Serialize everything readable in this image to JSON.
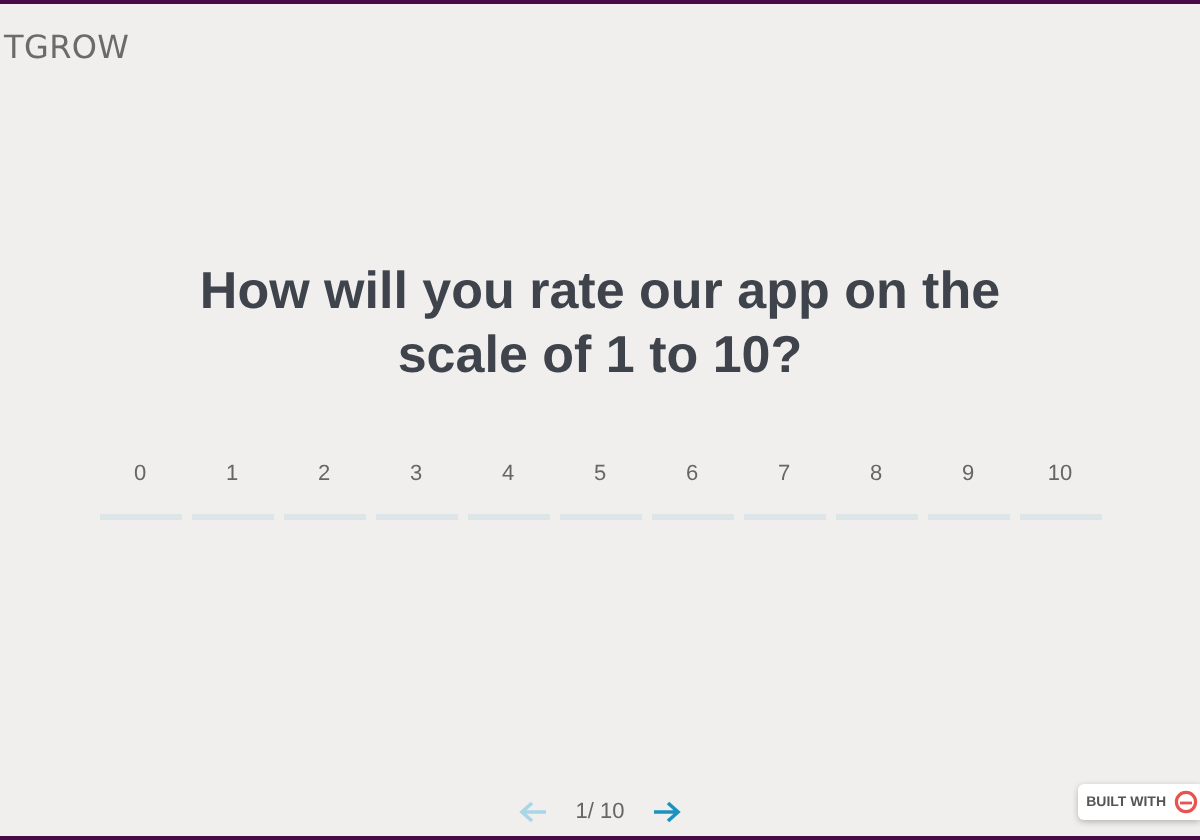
{
  "logo": {
    "text": "TGROW"
  },
  "question": {
    "title": "How will you rate our app on the scale of 1 to 10?"
  },
  "scale": [
    {
      "label": "0",
      "selected": false
    },
    {
      "label": "1",
      "selected": false
    },
    {
      "label": "2",
      "selected": false
    },
    {
      "label": "3",
      "selected": false
    },
    {
      "label": "4",
      "selected": false
    },
    {
      "label": "5",
      "selected": false
    },
    {
      "label": "6",
      "selected": false
    },
    {
      "label": "7",
      "selected": false
    },
    {
      "label": "8",
      "selected": false
    },
    {
      "label": "9",
      "selected": false
    },
    {
      "label": "10",
      "selected": false
    }
  ],
  "navigation": {
    "previous_disabled": true,
    "progress": "1/ 10",
    "next_disabled": false
  },
  "badge": {
    "text": "BUILT WITH"
  }
}
